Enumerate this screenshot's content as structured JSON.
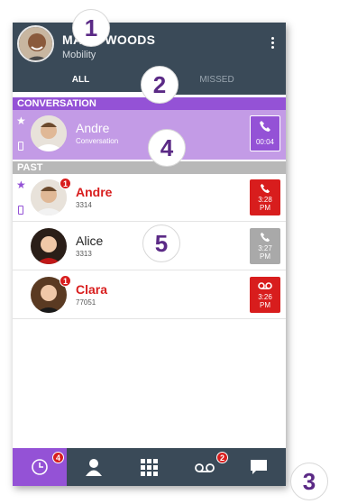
{
  "header": {
    "name": "MARK WOODS",
    "subtitle": "Mobility"
  },
  "tabs": [
    {
      "label": "ALL",
      "active": true
    },
    {
      "label": "MISSED",
      "active": false
    }
  ],
  "sections": {
    "conversation": "CONVERSATION",
    "past": "PAST"
  },
  "active_call": {
    "name": "Andre",
    "status": "Conversation",
    "time": "00:04",
    "favorite": true,
    "device": "mobile"
  },
  "past_calls": [
    {
      "name": "Andre",
      "number": "3314",
      "time": "3:28",
      "ampm": "PM",
      "type": "missed-call",
      "favorite": true,
      "device": "mobile",
      "badge": "1"
    },
    {
      "name": "Alice",
      "number": "3313",
      "time": "3:27",
      "ampm": "PM",
      "type": "answered-call",
      "favorite": false,
      "device": "",
      "badge": ""
    },
    {
      "name": "Clara",
      "number": "77051",
      "time": "3:26",
      "ampm": "PM",
      "type": "voicemail",
      "favorite": false,
      "device": "",
      "badge": "1"
    }
  ],
  "nav": [
    {
      "icon": "clock-icon",
      "badge": "4",
      "active": true
    },
    {
      "icon": "contact-icon",
      "badge": "",
      "active": false
    },
    {
      "icon": "dialpad-icon",
      "badge": "",
      "active": false
    },
    {
      "icon": "voicemail-icon",
      "badge": "2",
      "active": false
    },
    {
      "icon": "chat-icon",
      "badge": "",
      "active": false
    }
  ],
  "callouts": [
    "1",
    "2",
    "3",
    "4",
    "5"
  ],
  "colors": {
    "header": "#3a4a58",
    "accent": "#9452d6",
    "missed": "#d81d1d",
    "answered": "#a9a9a9"
  }
}
